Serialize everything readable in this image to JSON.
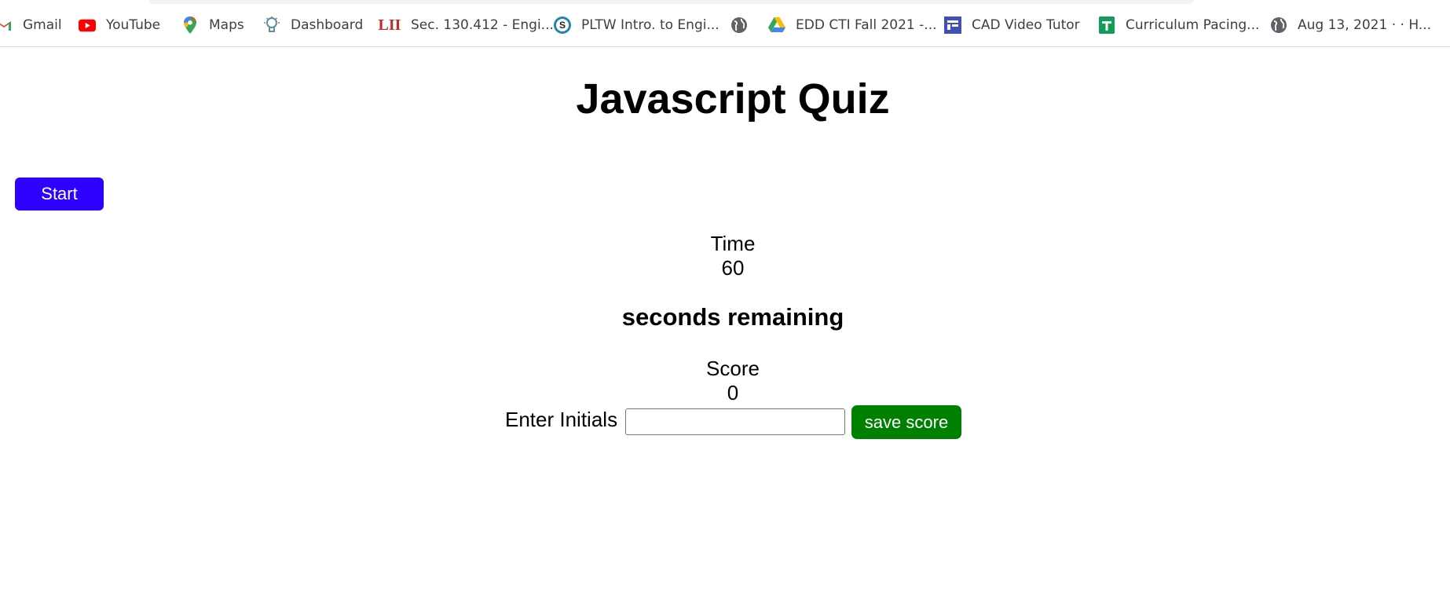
{
  "bookmarks": [
    {
      "label": "Gmail",
      "icon": "gmail-icon"
    },
    {
      "label": "YouTube",
      "icon": "youtube-icon"
    },
    {
      "label": "Maps",
      "icon": "maps-icon"
    },
    {
      "label": "Dashboard",
      "icon": "dashboard-icon"
    },
    {
      "label": "Sec. 130.412 - Engi...",
      "icon": "lii-icon",
      "icon_text": "LII"
    },
    {
      "label": "PLTW Intro. to Engi...",
      "icon": "skype-icon",
      "icon_text": "S"
    },
    {
      "label": "",
      "icon": "globe-icon"
    },
    {
      "label": "EDD CTI Fall 2021 -...",
      "icon": "google-drive-icon"
    },
    {
      "label": "CAD Video Tutor",
      "icon": "cad-tutor-icon"
    },
    {
      "label": "Curriculum Pacing...",
      "icon": "google-sheets-icon"
    },
    {
      "label": "Aug 13, 2021 ·  · H...",
      "icon": "globe-icon"
    }
  ],
  "page": {
    "title": "Javascript Quiz",
    "start_label": "Start",
    "time_label": "Time",
    "time_value": "60",
    "seconds_remaining": "seconds remaining",
    "score_label": "Score",
    "score_value": "0",
    "initials_label": "Enter Initials",
    "initials_value": "",
    "save_label": "save score"
  },
  "colors": {
    "start_button": "#2e00ff",
    "save_button": "#008000"
  }
}
